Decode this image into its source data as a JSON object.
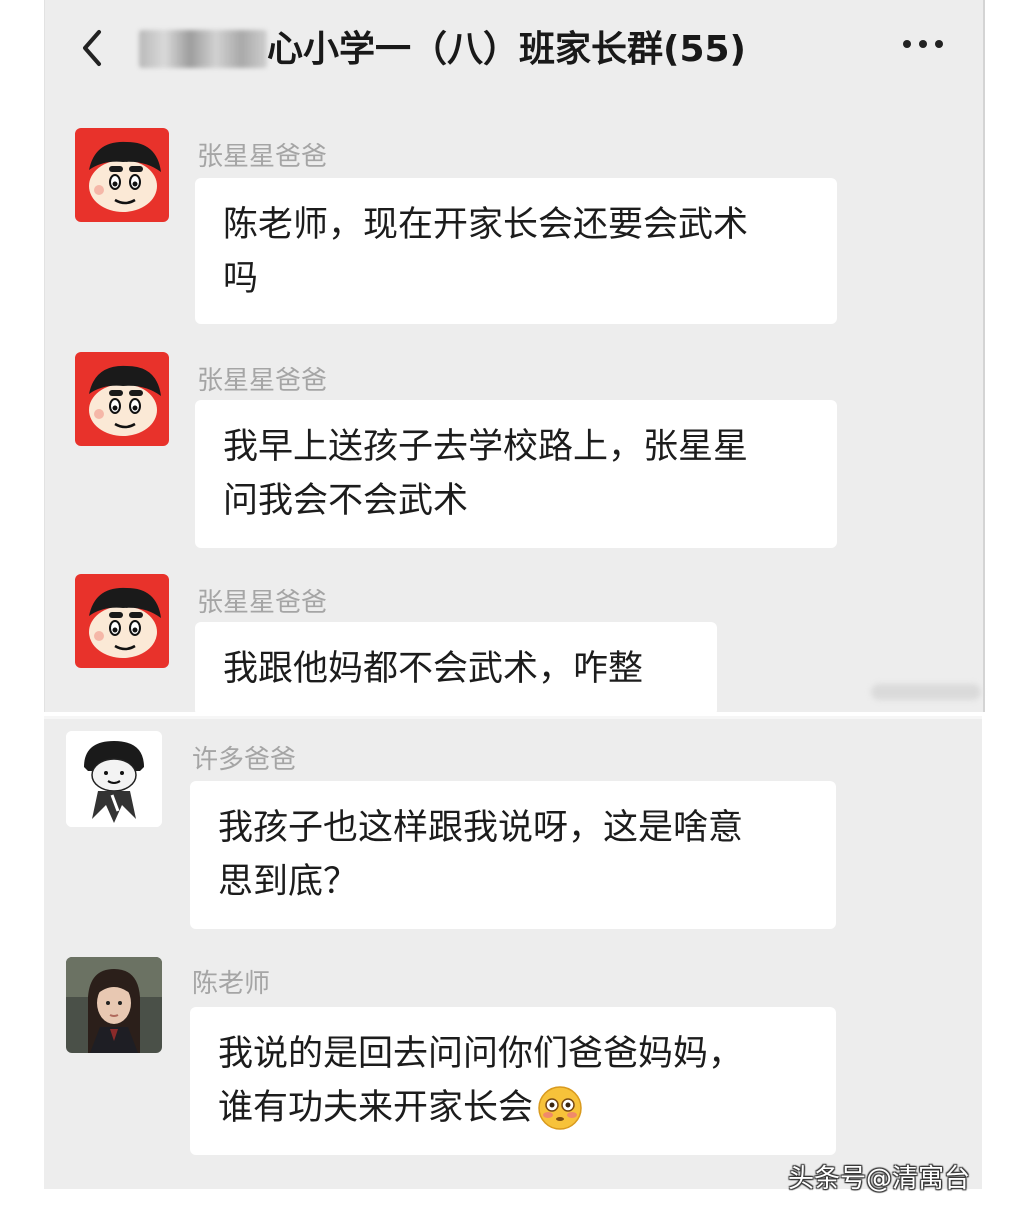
{
  "header": {
    "title": "心小学一（八）班家长群(55)"
  },
  "messages": [
    {
      "sender": "张星星爸爸",
      "lines": [
        "陈老师，现在开家长会还要会武术",
        "吗"
      ]
    },
    {
      "sender": "张星星爸爸",
      "lines": [
        "我早上送孩子去学校路上，张星星",
        "问我会不会武术"
      ]
    },
    {
      "sender": "张星星爸爸",
      "lines": [
        "我跟他妈都不会武术，咋整"
      ]
    },
    {
      "sender": "许多爸爸",
      "lines": [
        "我孩子也这样跟我说呀，这是啥意",
        "思到底？"
      ]
    },
    {
      "sender": "陈老师",
      "lines": [
        "我说的是回去问问你们爸爸妈妈，",
        "谁有功夫来开家长会"
      ]
    }
  ],
  "watermark": "头条号@清寓台",
  "colors": {
    "chat_background": "#ededed",
    "bubble": "#ffffff",
    "avatar_red": "#e8322b"
  },
  "icons": {
    "back": "chevron-left-icon",
    "more": "more-dots-icon",
    "emoji": "flushed-face-emoji"
  }
}
